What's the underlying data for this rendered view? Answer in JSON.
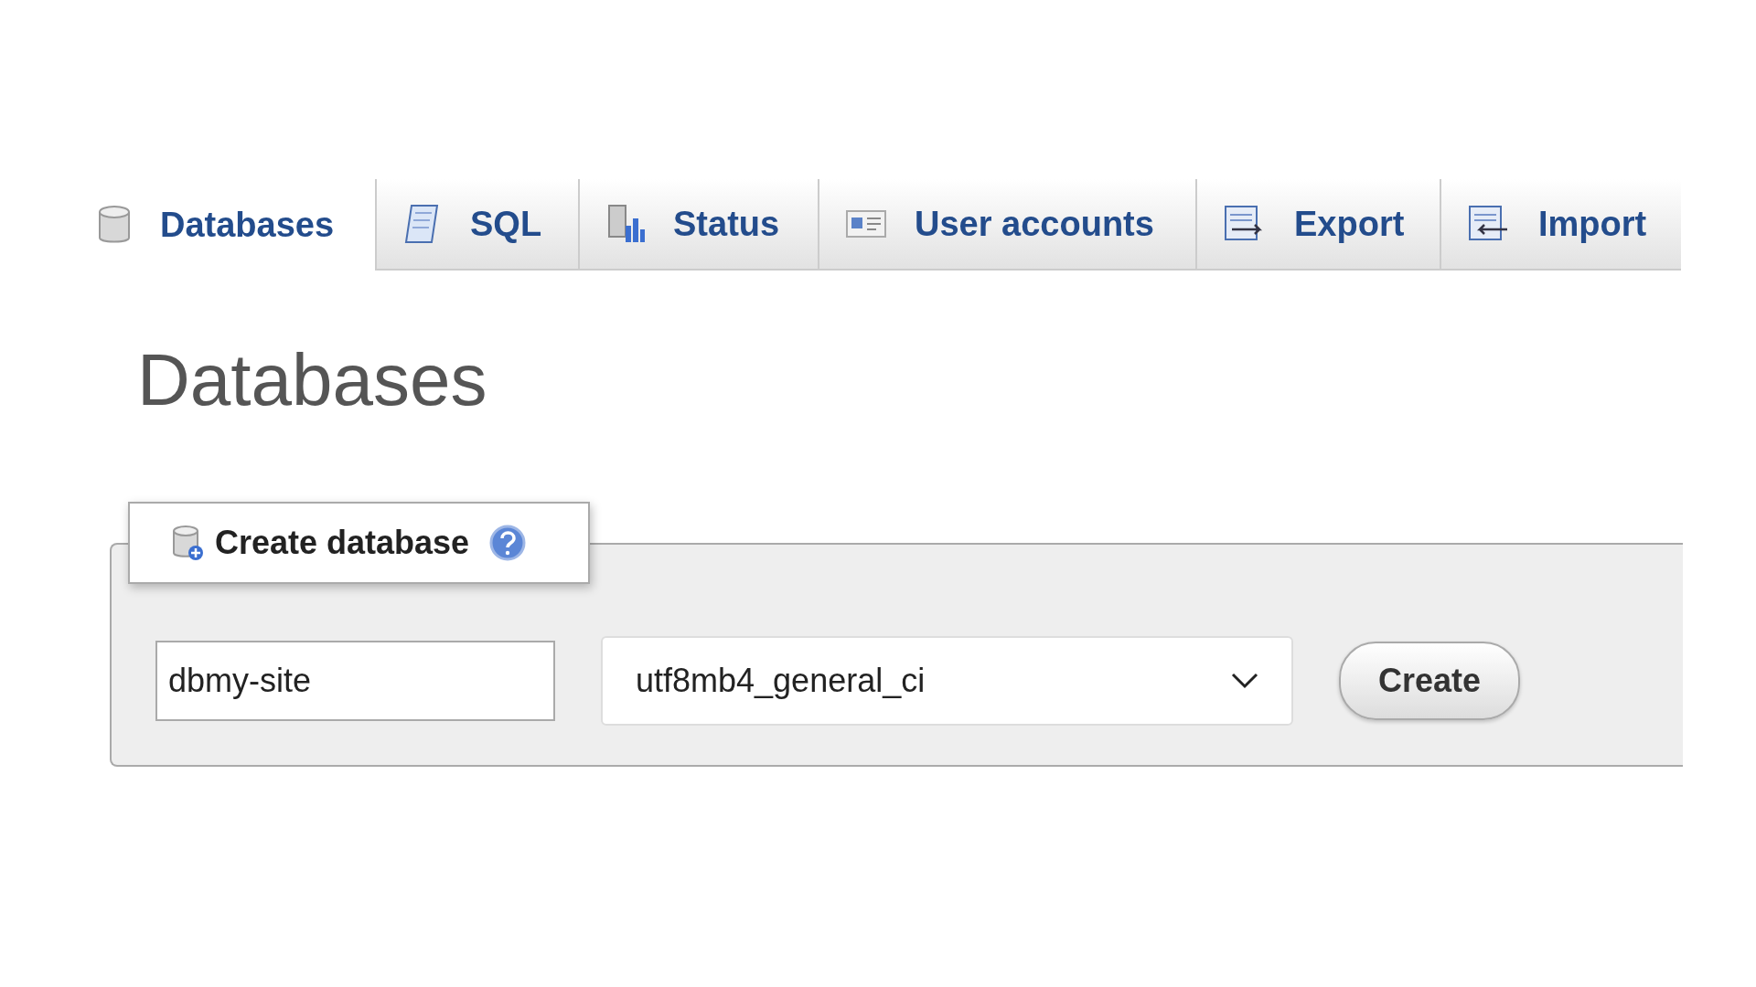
{
  "tabs": [
    {
      "label": "Databases",
      "selected": true
    },
    {
      "label": "SQL",
      "selected": false
    },
    {
      "label": "Status",
      "selected": false
    },
    {
      "label": "User accounts",
      "selected": false
    },
    {
      "label": "Export",
      "selected": false
    },
    {
      "label": "Import",
      "selected": false
    }
  ],
  "heading": "Databases",
  "create_database": {
    "legend": "Create database",
    "name_field": {
      "value": "dbmy-site"
    },
    "collation": {
      "value": "utf8mb4_general_ci"
    },
    "button": "Create"
  }
}
